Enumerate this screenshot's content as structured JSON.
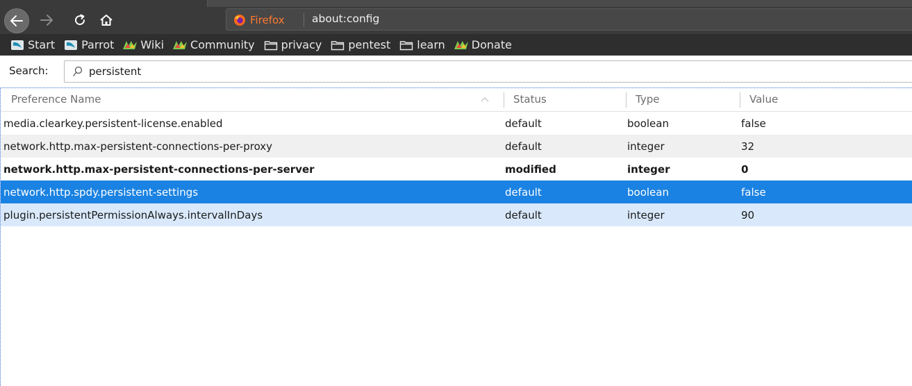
{
  "toolbar": {
    "identity_label": "Firefox",
    "url": "about:config"
  },
  "bookmarks": [
    {
      "label": "Start",
      "icon": "parrot-icon"
    },
    {
      "label": "Parrot",
      "icon": "parrot-icon"
    },
    {
      "label": "Wiki",
      "icon": "parrot-logo-icon"
    },
    {
      "label": "Community",
      "icon": "parrot-logo-icon"
    },
    {
      "label": "privacy",
      "icon": "folder-icon"
    },
    {
      "label": "pentest",
      "icon": "folder-icon"
    },
    {
      "label": "learn",
      "icon": "folder-icon"
    },
    {
      "label": "Donate",
      "icon": "parrot-logo-icon"
    }
  ],
  "search": {
    "label": "Search:",
    "value": "persistent"
  },
  "table": {
    "columns": [
      "Preference Name",
      "Status",
      "Type",
      "Value"
    ],
    "rows": [
      {
        "name": "media.clearkey.persistent-license.enabled",
        "status": "default",
        "type": "boolean",
        "value": "false",
        "state": "normal"
      },
      {
        "name": "network.http.max-persistent-connections-per-proxy",
        "status": "default",
        "type": "integer",
        "value": "32",
        "state": "alt"
      },
      {
        "name": "network.http.max-persistent-connections-per-server",
        "status": "modified",
        "type": "integer",
        "value": "0",
        "state": "bold"
      },
      {
        "name": "network.http.spdy.persistent-settings",
        "status": "default",
        "type": "boolean",
        "value": "false",
        "state": "selected"
      },
      {
        "name": "plugin.persistentPermissionAlways.intervalInDays",
        "status": "default",
        "type": "integer",
        "value": "90",
        "state": "hover"
      }
    ]
  },
  "colors": {
    "selection": "#1a82e2",
    "hover": "#d9e9fb",
    "identity": "#ff7a30"
  }
}
